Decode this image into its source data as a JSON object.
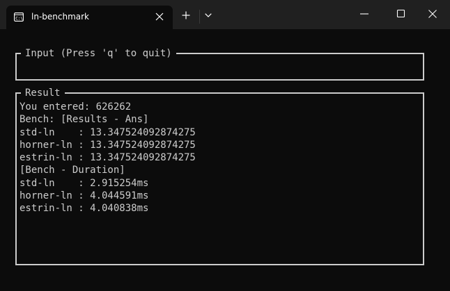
{
  "tab": {
    "title": "ln-benchmark"
  },
  "icons": {
    "tab_icon": "terminal-icon",
    "close": "close-icon",
    "new_tab": "plus-icon",
    "dropdown": "chevron-down-icon",
    "minimize": "minimize-icon",
    "maximize": "maximize-icon",
    "window_close": "close-icon"
  },
  "colors": {
    "background": "#0c0c0c",
    "titlebar": "#202020",
    "text": "#cccccc",
    "border": "#cccccc"
  },
  "input_pane": {
    "title": "Input (Press 'q' to quit)"
  },
  "result_pane": {
    "title": "Result",
    "lines": [
      "You entered: 626262",
      "Bench: [Results - Ans]",
      "std-ln    : 13.347524092874275",
      "horner-ln : 13.347524092874275",
      "estrin-ln : 13.347524092874275",
      "[Bench - Duration]",
      "std-ln    : 2.915254ms",
      "horner-ln : 4.044591ms",
      "estrin-ln : 4.040838ms"
    ]
  }
}
